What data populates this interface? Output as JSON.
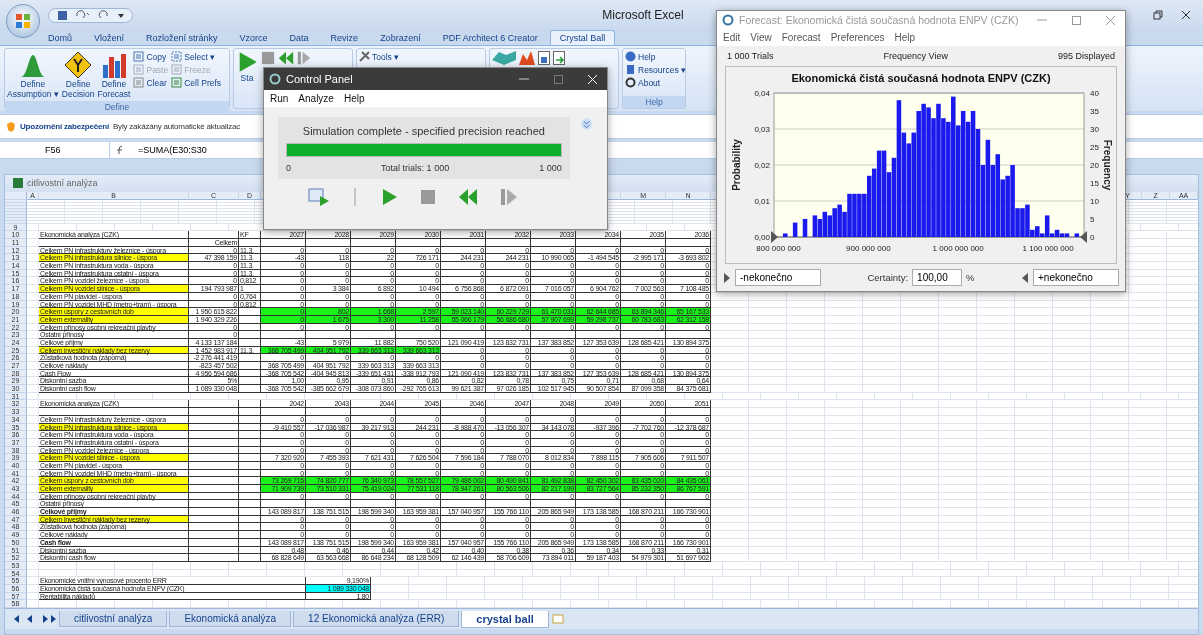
{
  "app": {
    "title": "Microsoft Excel"
  },
  "ribbon": {
    "tabs": [
      {
        "label": "Domů",
        "selected": false
      },
      {
        "label": "Vložení",
        "selected": false
      },
      {
        "label": "Rozložení stránky",
        "selected": false
      },
      {
        "label": "Vzorce",
        "selected": false
      },
      {
        "label": "Data",
        "selected": false
      },
      {
        "label": "Revize",
        "selected": false
      },
      {
        "label": "Zobrazení",
        "selected": false
      },
      {
        "label": "PDF Architect 6 Creator",
        "selected": false
      },
      {
        "label": "Crystal Ball",
        "selected": true
      }
    ],
    "define_group": {
      "label": "Define",
      "big": [
        {
          "kind": "assumption",
          "line1": "Define",
          "line2": "Assumption ▾"
        },
        {
          "kind": "decision",
          "line1": "Define",
          "line2": "Decision"
        },
        {
          "kind": "forecast",
          "line1": "Define",
          "line2": "Forecast"
        }
      ],
      "small": [
        {
          "kind": "copy",
          "label": "Copy",
          "disabled": false
        },
        {
          "kind": "paste",
          "label": "Paste",
          "disabled": true
        },
        {
          "kind": "clear",
          "label": "Clear",
          "disabled": false
        },
        {
          "kind": "select",
          "label": "Select ▾",
          "disabled": false
        },
        {
          "kind": "freeze",
          "label": "Freeze",
          "disabled": true
        },
        {
          "kind": "prefs",
          "label": "Cell Prefs",
          "disabled": false
        }
      ]
    },
    "run_group": {
      "start": "Sta",
      "tools": "Tools ▾"
    },
    "help_group": {
      "label": "Help",
      "items": [
        {
          "kind": "help",
          "label": "Help"
        },
        {
          "kind": "resources",
          "label": "Resources ▾"
        },
        {
          "kind": "about",
          "label": "About"
        }
      ]
    }
  },
  "security_bar": {
    "title": "Upozornění zabezpečení",
    "message": "Byly zakázány automatické aktualizac"
  },
  "formula_bar": {
    "name_box": "F56",
    "formula": "=SUMA(E30:S30"
  },
  "workbook": {
    "title": "citlivostní analýza",
    "columns": [
      "A",
      "B",
      "C",
      "D"
    ],
    "columns_right_of_panel": [
      "M",
      "N"
    ],
    "right_columns": [
      "Y",
      "Z",
      "AA"
    ],
    "rows": [
      {
        "n": "9",
        "kind": "blank"
      },
      {
        "n": "10",
        "kind": "header",
        "label": "Ekonomická analýza (CZK)",
        "d": "KF",
        "v": [
          "2027",
          "2028",
          "2029",
          "2030",
          "2031",
          "2032",
          "2033",
          "2034",
          "2035",
          "2036"
        ]
      },
      {
        "n": "11",
        "kind": "data",
        "c": "Celkem"
      },
      {
        "n": "12",
        "kind": "data",
        "label": "Celkem PN infrastruktury železnice - úspora",
        "c": "0",
        "d": "11.3.",
        "v": [
          "0",
          "0",
          "0",
          "0",
          "0",
          "0",
          "0",
          "0",
          "0",
          "0"
        ]
      },
      {
        "n": "13",
        "kind": "data",
        "label": "Celkem PN infrastruktura silnice - úspora",
        "highlight": true,
        "c": "47 398 159",
        "d": "11.3.",
        "v": [
          "-43",
          "118",
          "22",
          "726 171",
          "244 231",
          "244 231",
          "10 990 065",
          "-1 494 545",
          "-2 995 171",
          "-3 693 802"
        ]
      },
      {
        "n": "14",
        "kind": "data",
        "label": "Celkem PN infrastruktura voda - úspora",
        "c": "0",
        "d": "11.3.",
        "v": [
          "0",
          "0",
          "0",
          "0",
          "0",
          "0",
          "0",
          "0",
          "0",
          "0"
        ]
      },
      {
        "n": "15",
        "kind": "data",
        "label": "Celkem PN infrastruktura ostatní - úspora",
        "c": "0",
        "d": "11.3.",
        "v": [
          "0",
          "0",
          "0",
          "0",
          "0",
          "0",
          "0",
          "0",
          "0",
          "0"
        ]
      },
      {
        "n": "16",
        "kind": "data",
        "label": "Celkem PN vozidel železnice - úspora",
        "c": "0",
        "d": "0,812",
        "v": [
          "0",
          "0",
          "0",
          "0",
          "0",
          "0",
          "0",
          "0",
          "0",
          "0"
        ]
      },
      {
        "n": "17",
        "kind": "data",
        "label": "Celkem PN vozidel silnice - úspora",
        "highlight": true,
        "c": "194 793 987",
        "d": "1",
        "v": [
          "0",
          "3 384",
          "6 892",
          "10 494",
          "6 756 868",
          "6 872 091",
          "7 016 057",
          "6 904 762",
          "7 002 563",
          "7 108 485"
        ]
      },
      {
        "n": "18",
        "kind": "data",
        "label": "Celkem PN plavidel - úspora",
        "c": "0",
        "d": "0,764",
        "v": [
          "0",
          "0",
          "0",
          "0",
          "0",
          "0",
          "0",
          "0",
          "0",
          "0"
        ]
      },
      {
        "n": "19",
        "kind": "data",
        "label": "Celkem PN vozidel MHD (metro+tram) - úspora",
        "c": "0",
        "d": "0,812",
        "v": [
          "0",
          "0",
          "0",
          "0",
          "0",
          "0",
          "0",
          "0",
          "0",
          "0"
        ]
      },
      {
        "n": "20",
        "kind": "data",
        "label": "Celkem úspory z cestovních dob",
        "highlight": true,
        "c": "1 950 615 822",
        "v": [
          "0",
          "802",
          "1 668",
          "2 597",
          "59 023 140",
          "60 229 729",
          "61 470 031",
          "62 644 685",
          "63 894 346",
          "65 167 533"
        ],
        "fill": [
          true,
          true,
          true,
          true,
          true,
          true,
          true,
          true,
          true,
          true
        ]
      },
      {
        "n": "21",
        "kind": "data",
        "label": "Celkem externality",
        "highlight": true,
        "c": "1 940 329 226",
        "v": [
          "0",
          "1 675",
          "3 300",
          "11 258",
          "55 066 179",
          "56 686 680",
          "57 907 699",
          "59 298 737",
          "60 783 683",
          "62 312 158"
        ],
        "fill": [
          true,
          true,
          true,
          true,
          true,
          true,
          true,
          true,
          true,
          true
        ]
      },
      {
        "n": "22",
        "kind": "data",
        "label": "Celkem přínosy osobní rekreační plavby",
        "c": "0",
        "v": [
          "0",
          "0",
          "0",
          "0",
          "0",
          "0",
          "0",
          "0",
          "0",
          "0"
        ]
      },
      {
        "n": "23",
        "kind": "data",
        "label": "Ostatní přínosy",
        "c": "0"
      },
      {
        "n": "24",
        "kind": "data",
        "label": "Celkové příjmy",
        "c": "4 133 137 184",
        "v": [
          "-43",
          "5 979",
          "11 882",
          "750 520",
          "121 090 419",
          "123 832 731",
          "137 383 852",
          "127 353 639",
          "128 685 421",
          "130 894 375"
        ]
      },
      {
        "n": "25",
        "kind": "data",
        "label": "Celkem investiční náklady bez rezervy",
        "highlight": true,
        "c": "1 452 983 917",
        "d": "11.3.",
        "v": [
          "368 705 499",
          "404 951 792",
          "339 663 313",
          "339 663 313",
          "0",
          "0",
          "0",
          "0",
          "0",
          "0"
        ],
        "fill": [
          true,
          true,
          true,
          true,
          false,
          false,
          false,
          false,
          false,
          false
        ]
      },
      {
        "n": "26",
        "kind": "data",
        "label": "Zůstatková hodnota (záporná)",
        "c": "-2 276 441 419",
        "v": [
          "0",
          "0",
          "0",
          "0",
          "0",
          "0",
          "0",
          "0",
          "0",
          "0"
        ]
      },
      {
        "n": "27",
        "kind": "data",
        "label": "Celkové náklady",
        "c": "-823 457 502",
        "v": [
          "368 705 499",
          "404 951 792",
          "339 663 313",
          "339 663 313",
          "0",
          "0",
          "0",
          "0",
          "0",
          "0"
        ]
      },
      {
        "n": "28",
        "kind": "data",
        "label": "Cash Flow",
        "c": "4 956 594 686",
        "v": [
          "-368 705 542",
          "-404 945 813",
          "-339 651 431",
          "-338 912 793",
          "121 090 419",
          "123 832 731",
          "137 383 852",
          "127 353 639",
          "128 685 421",
          "130 894 375"
        ]
      },
      {
        "n": "29",
        "kind": "data",
        "label": "Diskontní sazba",
        "c": "5%",
        "v": [
          "1,00",
          "0,95",
          "0,91",
          "0,86",
          "0,82",
          "0,78",
          "0,75",
          "0,71",
          "0,68",
          "0,64"
        ]
      },
      {
        "n": "30",
        "kind": "data",
        "label": "Diskontní cash flow",
        "c": "1 089 330 048",
        "v": [
          "-368 705 542",
          "-385 662 679",
          "-308 073 860",
          "-292 765 613",
          "99 621 387",
          "97 026 185",
          "102 517 945",
          "90 507 854",
          "87 099 358",
          "84 375 681"
        ]
      },
      {
        "n": "31",
        "kind": "blank"
      },
      {
        "n": "32",
        "kind": "header",
        "label": "Ekonomická analýza (CZK)",
        "v": [
          "2042",
          "2043",
          "2044",
          "2045",
          "2046",
          "2047",
          "2048",
          "2049",
          "2050",
          "2051"
        ]
      },
      {
        "n": "33",
        "kind": "data"
      },
      {
        "n": "34",
        "kind": "data",
        "label": "Celkem PN infrastruktury železnice - úspora",
        "v": [
          "0",
          "0",
          "0",
          "0",
          "0",
          "0",
          "0",
          "0",
          "0",
          "0"
        ]
      },
      {
        "n": "35",
        "kind": "data",
        "label": "Celkem PN infrastruktura silnice - úspora",
        "highlight": true,
        "v": [
          "-9 410 557",
          "-17 036 987",
          "39 217 913",
          "244 231",
          "-8 988 470",
          "-13 056 307",
          "34 143 078",
          "-937 396",
          "-7 702 760",
          "-12 378 687"
        ]
      },
      {
        "n": "36",
        "kind": "data",
        "label": "Celkem PN infrastruktura voda - úspora",
        "v": [
          "0",
          "0",
          "0",
          "0",
          "0",
          "0",
          "0",
          "0",
          "0",
          "0"
        ]
      },
      {
        "n": "37",
        "kind": "data",
        "label": "Celkem PN infrastruktura ostatní - úspora",
        "v": [
          "0",
          "0",
          "0",
          "0",
          "0",
          "0",
          "0",
          "0",
          "0",
          "0"
        ]
      },
      {
        "n": "38",
        "kind": "data",
        "label": "Celkem PN vozidel železnice - úspora",
        "v": [
          "0",
          "0",
          "0",
          "0",
          "0",
          "0",
          "0",
          "0",
          "0",
          "0"
        ]
      },
      {
        "n": "39",
        "kind": "data",
        "label": "Celkem PN vozidel silnice - úspora",
        "highlight": true,
        "v": [
          "7 320 920",
          "7 455 393",
          "7 621 431",
          "7 626 504",
          "7 596 184",
          "7 788 070",
          "8 012 834",
          "7 898 115",
          "7 905 606",
          "7 911 507"
        ]
      },
      {
        "n": "40",
        "kind": "data",
        "label": "Celkem PN plavidel - úspora",
        "v": [
          "0",
          "0",
          "0",
          "0",
          "0",
          "0",
          "0",
          "0",
          "0",
          "0"
        ]
      },
      {
        "n": "41",
        "kind": "data",
        "label": "Celkem PN vozidel MHD (metro+tram) - úspora",
        "v": [
          "0",
          "0",
          "0",
          "0",
          "0",
          "0",
          "0",
          "0",
          "0",
          "0"
        ]
      },
      {
        "n": "42",
        "kind": "data",
        "label": "Celkem úspory z cestovních dob",
        "highlight": true,
        "v": [
          "73 269 715",
          "74 820 777",
          "76 340 973",
          "78 557 527",
          "79 486 002",
          "80 490 841",
          "81 492 838",
          "82 450 302",
          "83 435 020",
          "84 435 061"
        ],
        "fill": [
          true,
          true,
          true,
          true,
          true,
          true,
          true,
          true,
          true,
          true
        ]
      },
      {
        "n": "43",
        "kind": "data",
        "label": "Celkem externality",
        "highlight": true,
        "v": [
          "71 909 739",
          "73 510 331",
          "75 419 024",
          "77 531 118",
          "78 947 261",
          "80 563 506",
          "82 217 199",
          "83 727 564",
          "85 232 350",
          "86 767 591"
        ],
        "fill": [
          true,
          true,
          true,
          true,
          true,
          true,
          true,
          true,
          true,
          true
        ]
      },
      {
        "n": "44",
        "kind": "data",
        "label": "Celkem přínosy osobní rekreační plavby",
        "v": [
          "0",
          "0",
          "0",
          "0",
          "0",
          "0",
          "0",
          "0",
          "0",
          "0"
        ]
      },
      {
        "n": "45",
        "kind": "data",
        "label": "Ostatní přínosy"
      },
      {
        "n": "46",
        "kind": "data",
        "label": "Celkové příjmy",
        "bold": true,
        "v": [
          "143 089 817",
          "138 751 515",
          "198 599 340",
          "163 959 381",
          "157 040 957",
          "155 766 110",
          "205 865 949",
          "173 138 585",
          "168 870 211",
          "166 730 901"
        ]
      },
      {
        "n": "47",
        "kind": "data",
        "label": "Celkem investiční náklady bez rezervy",
        "highlight": true,
        "v": [
          "0",
          "0",
          "0",
          "0",
          "0",
          "0",
          "0",
          "0",
          "0",
          "0"
        ]
      },
      {
        "n": "48",
        "kind": "data",
        "label": "Zůstatková hodnota (záporná)",
        "v": [
          "0",
          "0",
          "0",
          "0",
          "0",
          "0",
          "0",
          "0",
          "0",
          "0"
        ]
      },
      {
        "n": "49",
        "kind": "data",
        "label": "Celkové náklady",
        "v": [
          "0",
          "0",
          "0",
          "0",
          "0",
          "0",
          "0",
          "0",
          "0",
          "0"
        ]
      },
      {
        "n": "50",
        "kind": "data",
        "label": "Cash flow",
        "bold": true,
        "v": [
          "143 089 817",
          "138 751 515",
          "198 599 340",
          "163 959 381",
          "157 040 957",
          "155 766 110",
          "205 865 949",
          "173 138 585",
          "168 870 211",
          "166 730 901"
        ]
      },
      {
        "n": "51",
        "kind": "data",
        "label": "Diskontní sazba",
        "v": [
          "0,48",
          "0,46",
          "0,44",
          "0,42",
          "0,40",
          "0,38",
          "0,36",
          "0,34",
          "0,33",
          "0,31"
        ]
      },
      {
        "n": "52",
        "kind": "data",
        "label": "Diskontní cash flow",
        "v": [
          "68 828 649",
          "63 563 668",
          "86 648 234",
          "68 128 509",
          "62 146 439",
          "58 706 609",
          "73 894 011",
          "59 187 403",
          "54 979 301",
          "51 697 902"
        ]
      },
      {
        "n": "53",
        "kind": "blank"
      },
      {
        "n": "54",
        "kind": "blank"
      },
      {
        "n": "55",
        "kind": "summary",
        "label": "Ekonomické vnitřní výnosové procento ERR",
        "value": "9,190%"
      },
      {
        "n": "56",
        "kind": "summary",
        "label": "Ekonomická čistá současná hodnota ENPV (CZK)",
        "value": "1 089 330 048",
        "highlight": true
      },
      {
        "n": "57",
        "kind": "summary",
        "label": "Rentabilita nákladů",
        "value": "1,80"
      },
      {
        "n": "58",
        "kind": "blank"
      }
    ],
    "sheet_tabs": [
      {
        "label": "citlivostní analýza",
        "selected": false
      },
      {
        "label": "Ekonomická analýza",
        "selected": false
      },
      {
        "label": "12 Ekonomická analýza (ERR)",
        "selected": false
      },
      {
        "label": "crystal ball",
        "selected": true
      }
    ]
  },
  "control_panel": {
    "title": "Control Panel",
    "menu": [
      "Run",
      "Analyze",
      "Help"
    ],
    "status": "Simulation complete - specified precision reached",
    "progress": {
      "level": 1.0,
      "min": "0",
      "caption": "Total trials: 1 000",
      "max": "1 000"
    }
  },
  "forecast": {
    "title": "Forecast: Ekonomická čistá současná hodnota ENPV (CZK)",
    "menu": [
      "Edit",
      "View",
      "Forecast",
      "Preferences",
      "Help"
    ],
    "trials": "1 000 Trials",
    "view": "Frequency View",
    "displayed": "995 Displayed",
    "chart_data": {
      "type": "bar",
      "grid": true,
      "title": "Ekonomická čistá současná hodnota ENPV (CZK)",
      "ylabel": "Frequency",
      "y2label": "Probability",
      "x": [
        805000000,
        810500000,
        816000000,
        821500000,
        827000000,
        832500000,
        838000000,
        843500000,
        849000000,
        854500000,
        860000000,
        865500000,
        871000000,
        876500000,
        882000000,
        887500000,
        893000000,
        898500000,
        904000000,
        909500000,
        915000000,
        920500000,
        926000000,
        931500000,
        937000000,
        942500000,
        948000000,
        953500000,
        959000000,
        964500000,
        970000000,
        975500000,
        981000000,
        986500000,
        992000000,
        997500000,
        1003000000,
        1008500000,
        1014000000,
        1019500000,
        1025000000,
        1030500000,
        1036000000,
        1041500000,
        1047000000,
        1052500000,
        1058000000,
        1063500000,
        1069000000,
        1074500000,
        1080000000,
        1085500000,
        1091000000,
        1096500000,
        1102000000,
        1107500000,
        1113000000,
        1118500000,
        1124000000,
        1129500000
      ],
      "values": [
        1,
        0,
        4,
        0,
        5,
        0,
        6,
        5,
        7,
        6,
        8,
        9,
        7,
        12,
        12,
        12,
        12,
        17,
        19,
        24,
        24,
        18,
        22,
        38,
        29,
        26,
        29,
        35,
        37,
        36,
        33,
        37,
        33,
        32,
        39,
        31,
        35,
        32,
        35,
        30,
        20,
        27,
        20,
        23,
        16,
        17,
        20,
        8,
        8,
        9,
        2,
        3,
        1,
        6,
        1,
        2,
        1,
        1,
        0,
        1
      ],
      "xlim": [
        795000000,
        1140000000
      ],
      "ylim": [
        0,
        40
      ],
      "xticks": [
        {
          "value": 800000000,
          "label": "800 000 000"
        },
        {
          "value": 900000000,
          "label": "900 000 000"
        },
        {
          "value": 1000000000,
          "label": "1 000 000 000"
        },
        {
          "value": 1100000000,
          "label": "1 100 000 000"
        }
      ],
      "yticks": [
        0,
        5,
        10,
        15,
        20,
        25,
        30,
        35,
        40
      ],
      "y2lim": [
        0,
        0.04
      ],
      "y2ticks": [
        {
          "value": 0,
          "label": "0,00"
        },
        {
          "value": 0.01,
          "label": "0,01"
        },
        {
          "value": 0.02,
          "label": "0,02"
        },
        {
          "value": 0.03,
          "label": "0,03"
        },
        {
          "value": 0.04,
          "label": "0,04"
        }
      ]
    },
    "lower": "-nekonečno",
    "certainty_label": "Certainty:",
    "certainty": "100,00",
    "percent": "%",
    "upper": "+nekonečno"
  }
}
